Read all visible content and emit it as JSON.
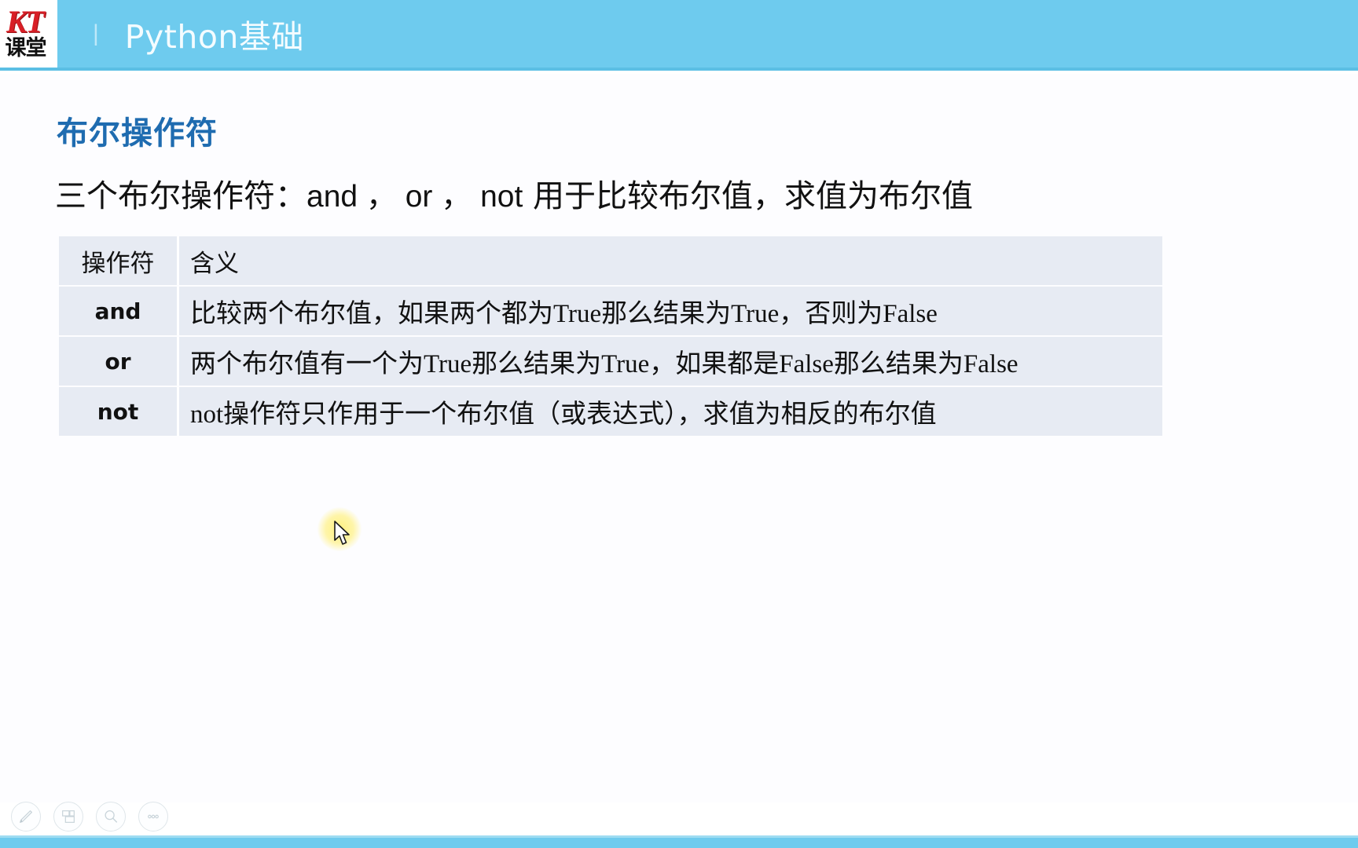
{
  "header": {
    "logo_primary": "KT",
    "logo_secondary": "课堂",
    "separator": "|",
    "title": "Python基础"
  },
  "slide": {
    "heading": "布尔操作符",
    "subtitle_prefix": "三个布尔操作符：",
    "subtitle_ops": "and ， or ， not",
    "subtitle_suffix": " 用于比较布尔值，求值为布尔值",
    "subtitle_full": "三个布尔操作符：and ， or ， not 用于比较布尔值，求值为布尔值"
  },
  "table": {
    "headers": [
      "操作符",
      "含义"
    ],
    "rows": [
      {
        "operator": "and",
        "meaning": "比较两个布尔值，如果两个都为True那么结果为True，否则为False"
      },
      {
        "operator": "or",
        "meaning": "两个布尔值有一个为True那么结果为True，如果都是False那么结果为False"
      },
      {
        "operator": "not",
        "meaning": "not操作符只作用于一个布尔值（或表达式），求值为相反的布尔值"
      }
    ]
  },
  "toolbar": {
    "buttons": [
      {
        "name": "pen-icon",
        "label": "画笔"
      },
      {
        "name": "layers-icon",
        "label": "窗口"
      },
      {
        "name": "magnifier-icon",
        "label": "放大"
      },
      {
        "name": "more-icon",
        "label": "更多"
      }
    ]
  },
  "colors": {
    "header_blue": "#6ecbee",
    "heading_blue": "#1f6cb0",
    "table_row_bg": "#e7ebf3",
    "logo_red": "#d81f26",
    "cursor_glow": "#fff078"
  }
}
